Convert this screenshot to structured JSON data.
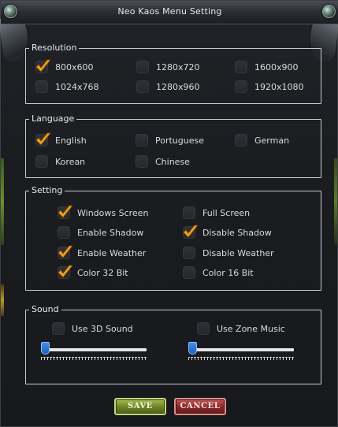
{
  "window": {
    "title": "Neo Kaos Menu Setting"
  },
  "colors": {
    "check": "#f5a11c",
    "save": "#6f8727",
    "cancel": "#8c2a29",
    "slider_thumb": "#2b74d8"
  },
  "resolution": {
    "legend": "Resolution",
    "options": [
      {
        "label": "800x600",
        "checked": true
      },
      {
        "label": "1280x720",
        "checked": false
      },
      {
        "label": "1600x900",
        "checked": false
      },
      {
        "label": "1024x768",
        "checked": false
      },
      {
        "label": "1280x960",
        "checked": false
      },
      {
        "label": "1920x1080",
        "checked": false
      }
    ]
  },
  "language": {
    "legend": "Language",
    "options": [
      {
        "label": "English",
        "checked": true
      },
      {
        "label": "Portuguese",
        "checked": false
      },
      {
        "label": "German",
        "checked": false
      },
      {
        "label": "Korean",
        "checked": false
      },
      {
        "label": "Chinese",
        "checked": false
      }
    ]
  },
  "setting": {
    "legend": "Setting",
    "options": [
      {
        "label": "Windows Screen",
        "checked": true
      },
      {
        "label": "Full Screen",
        "checked": false
      },
      {
        "label": "Enable Shadow",
        "checked": false
      },
      {
        "label": "Disable Shadow",
        "checked": true
      },
      {
        "label": "Enable Weather",
        "checked": true
      },
      {
        "label": "Disable Weather",
        "checked": false
      },
      {
        "label": "Color 32 Bit",
        "checked": true
      },
      {
        "label": "Color 16 Bit",
        "checked": false
      }
    ]
  },
  "sound": {
    "legend": "Sound",
    "options": [
      {
        "label": "Use 3D Sound",
        "checked": false,
        "slider_level": 0
      },
      {
        "label": "Use Zone Music",
        "checked": false,
        "slider_level": 0
      }
    ]
  },
  "buttons": {
    "save": "SAVE",
    "cancel": "CANCEL"
  }
}
